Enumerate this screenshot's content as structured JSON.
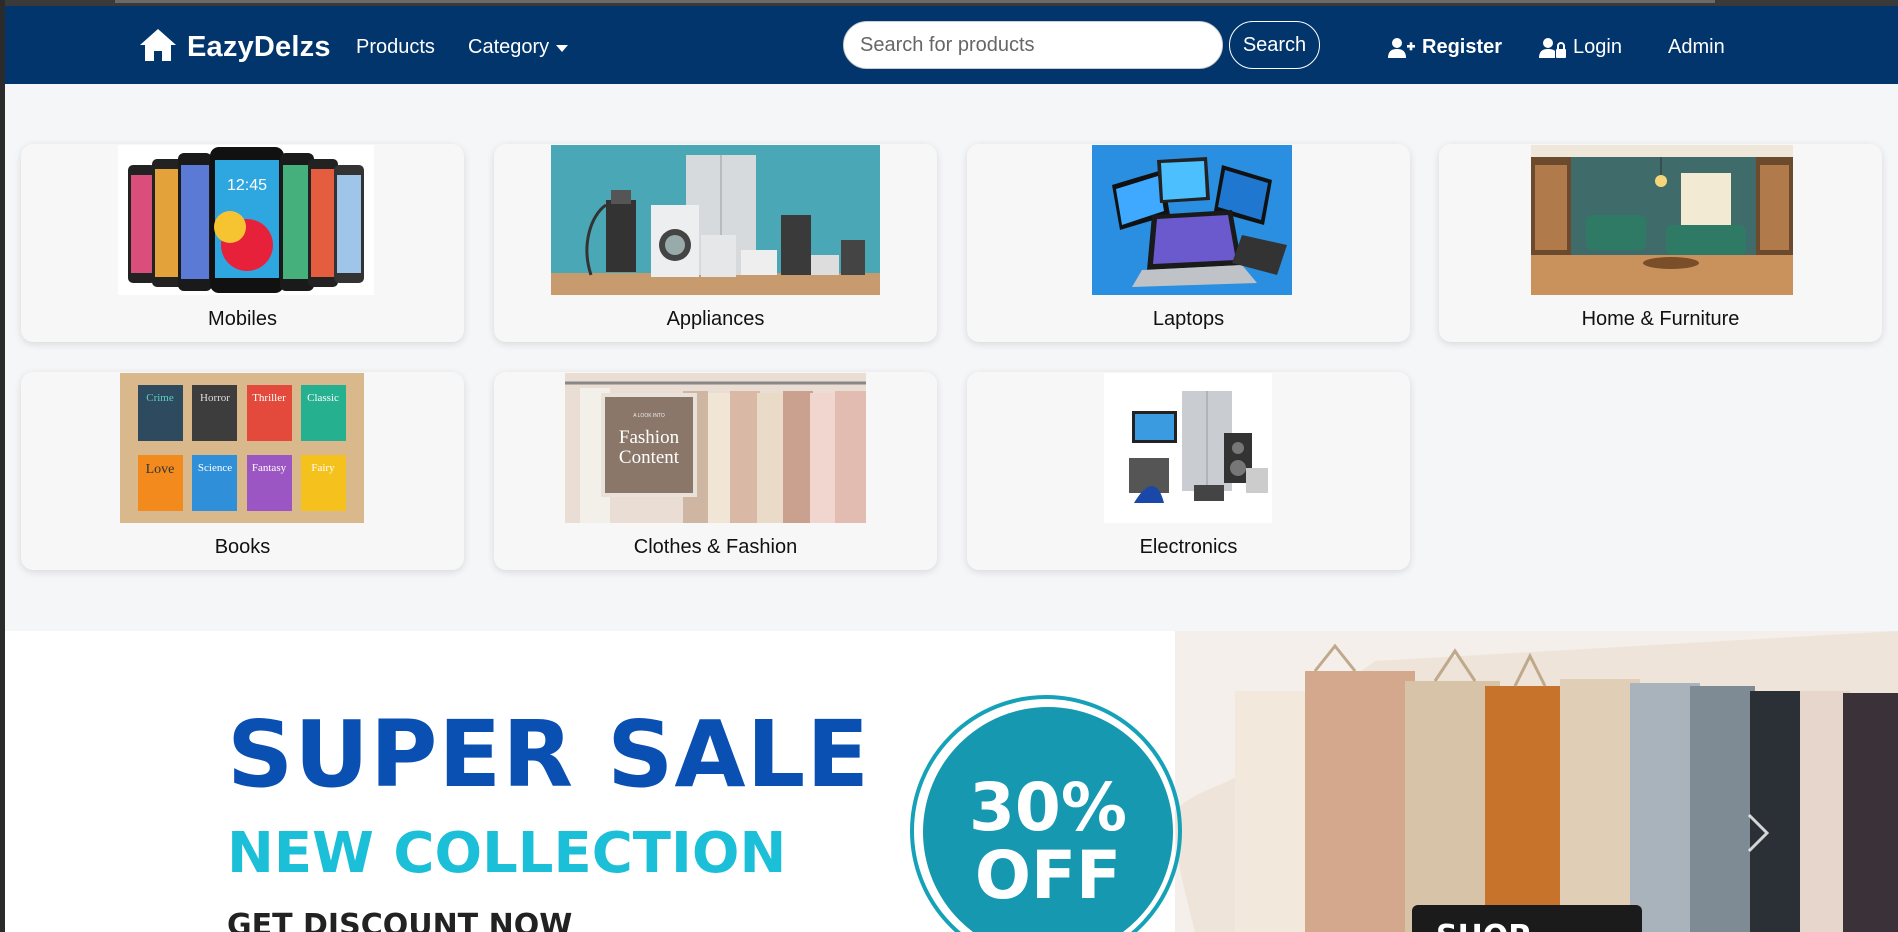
{
  "navbar": {
    "brand": "EazyDelzs",
    "products": "Products",
    "category": "Category",
    "search_placeholder": "Search for products",
    "search_button": "Search",
    "register": "Register",
    "login": "Login",
    "admin": "Admin"
  },
  "categories": [
    {
      "label": "Mobiles"
    },
    {
      "label": "Appliances"
    },
    {
      "label": "Laptops"
    },
    {
      "label": "Home & Furniture"
    },
    {
      "label": "Books",
      "tiles": [
        "Crime",
        "Horror",
        "Thriller",
        "Classic",
        "Love",
        "Science",
        "Fantasy",
        "Fairy"
      ]
    },
    {
      "label": "Clothes & Fashion",
      "sign_small": "A LOOK INTO",
      "sign_line1": "Fashion",
      "sign_line2": "Content"
    },
    {
      "label": "Electronics"
    }
  ],
  "banner": {
    "title": "SUPER SALE",
    "subtitle": "NEW COLLECTION",
    "cta_text": "GET DISCOUNT NOW",
    "badge_line1": "30%",
    "badge_line2": "OFF",
    "shop_button": "SHOP NOW"
  },
  "colors": {
    "navbar": "#02356b",
    "accent_blue": "#0a4fb2",
    "accent_cyan": "#1bbfd8",
    "badge": "#1698b0"
  }
}
